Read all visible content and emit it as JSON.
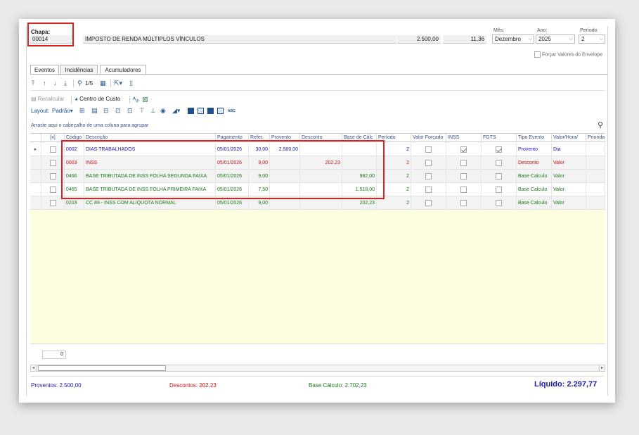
{
  "header": {
    "chapa_label": "Chapa:",
    "chapa_value": "00014",
    "description": "IMPOSTO DE RENDA MÚLTIPLOS VÍNCULOS",
    "amount": "2.500,00",
    "rate": "11,36",
    "mes_label": "Mês:",
    "mes_value": "Dezembro",
    "ano_label": "Ano:",
    "ano_value": "2025",
    "periodo_label": "Período",
    "periodo_value": "2",
    "forcar_label": "Forçar Valores do Envelope"
  },
  "tabs": [
    "Eventos",
    "Incidências",
    "Acumuladores"
  ],
  "toolbar": {
    "pager": "1/5",
    "recalcular": "Recalcular",
    "centro_custo": "Centro de Custo",
    "layout_label": "Layout:",
    "layout_value": "Padrão",
    "abc": "ABC"
  },
  "group_hint": "Arraste aqui o cabeçalho de uma coluna para agrupar",
  "columns": [
    "[x]",
    "Código",
    "Descrição",
    "Pagamento",
    "Refer.",
    "Provento",
    "Desconto",
    "Base de Cálc",
    "Período",
    "Valor Forçado",
    "INSS",
    "FGTS",
    "Tipo Evento",
    "Valor/Hora/",
    "Priorida"
  ],
  "rows": [
    {
      "codigo": "0002",
      "descricao": "DIAS TRABALHADOS",
      "pagamento": "05/01/2026",
      "refer": "30,00",
      "provento": "2.500,00",
      "desconto": "",
      "base": "",
      "periodo": "2",
      "inss": true,
      "fgts": true,
      "tipo": "Provento",
      "valor_hora": "Dia",
      "color": "#1a1ab4"
    },
    {
      "codigo": "0003",
      "descricao": "INSS",
      "pagamento": "05/01/2026",
      "refer": "9,00",
      "provento": "",
      "desconto": "202,23",
      "base": "",
      "periodo": "2",
      "inss": false,
      "fgts": false,
      "tipo": "Desconto",
      "valor_hora": "Valor",
      "color": "#d01010"
    },
    {
      "codigo": "0466",
      "descricao": "BASE TRIBUTADA DE INSS FOLHA SEGUNDA FAIXA",
      "pagamento": "05/01/2026",
      "refer": "9,00",
      "provento": "",
      "desconto": "",
      "base": "982,00",
      "periodo": "2",
      "inss": false,
      "fgts": false,
      "tipo": "Base Calculo",
      "valor_hora": "Valor",
      "color": "#1a7a1a"
    },
    {
      "codigo": "0465",
      "descricao": "BASE TRIBUTADA DE INSS FOLHA PRIMEIRA FAIXA",
      "pagamento": "05/01/2026",
      "refer": "7,50",
      "provento": "",
      "desconto": "",
      "base": "1.518,00",
      "periodo": "2",
      "inss": false,
      "fgts": false,
      "tipo": "Base Calculo",
      "valor_hora": "Valor",
      "color": "#1a7a1a"
    },
    {
      "codigo": "0203",
      "descricao": "CC 89 - INSS COM ALIQUOTA NORMAL",
      "pagamento": "05/01/2026",
      "refer": "9,00",
      "provento": "",
      "desconto": "",
      "base": "202,23",
      "periodo": "2",
      "inss": false,
      "fgts": false,
      "tipo": "Base Calculo",
      "valor_hora": "Valor",
      "color": "#1a7a1a"
    }
  ],
  "summary_count": "0",
  "totals": {
    "proventos_label": "Proventos:",
    "proventos_value": "2.500,00",
    "descontos_label": "Descontos:",
    "descontos_value": "202,23",
    "base_label": "Base Cálculo:",
    "base_value": "2.702,23",
    "liquido_label": "Líquido:",
    "liquido_value": "2.297,77"
  },
  "colors": {
    "accent": "#1e4f8f",
    "proventos": "#1a1ab4",
    "descontos": "#d01010",
    "base": "#1a7a1a",
    "highlight": "#e02020"
  }
}
